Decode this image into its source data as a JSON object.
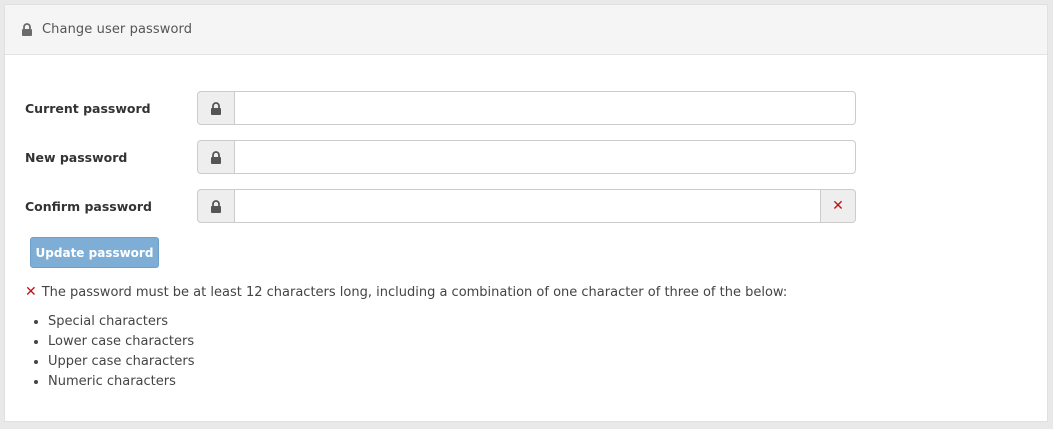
{
  "header": {
    "icon": "lock-icon",
    "title": "Change user password"
  },
  "form": {
    "current": {
      "label": "Current password",
      "icon": "lock-icon",
      "value": ""
    },
    "new": {
      "label": "New password",
      "icon": "lock-icon",
      "value": ""
    },
    "confirm": {
      "label": "Confirm password",
      "icon": "lock-icon",
      "value": "",
      "status_icon": "close-icon",
      "status_glyph": "✕"
    }
  },
  "update_button": {
    "label": "Update password"
  },
  "requirement": {
    "icon": "close-icon",
    "glyph": "✕",
    "text": "The password must be at least 12 characters long, including a combination of one character of three of the below:",
    "rules": [
      "Special characters",
      "Lower case characters",
      "Upper case characters",
      "Numeric characters"
    ]
  },
  "colors": {
    "error": "#c0141a",
    "button": "#7eaed6"
  }
}
